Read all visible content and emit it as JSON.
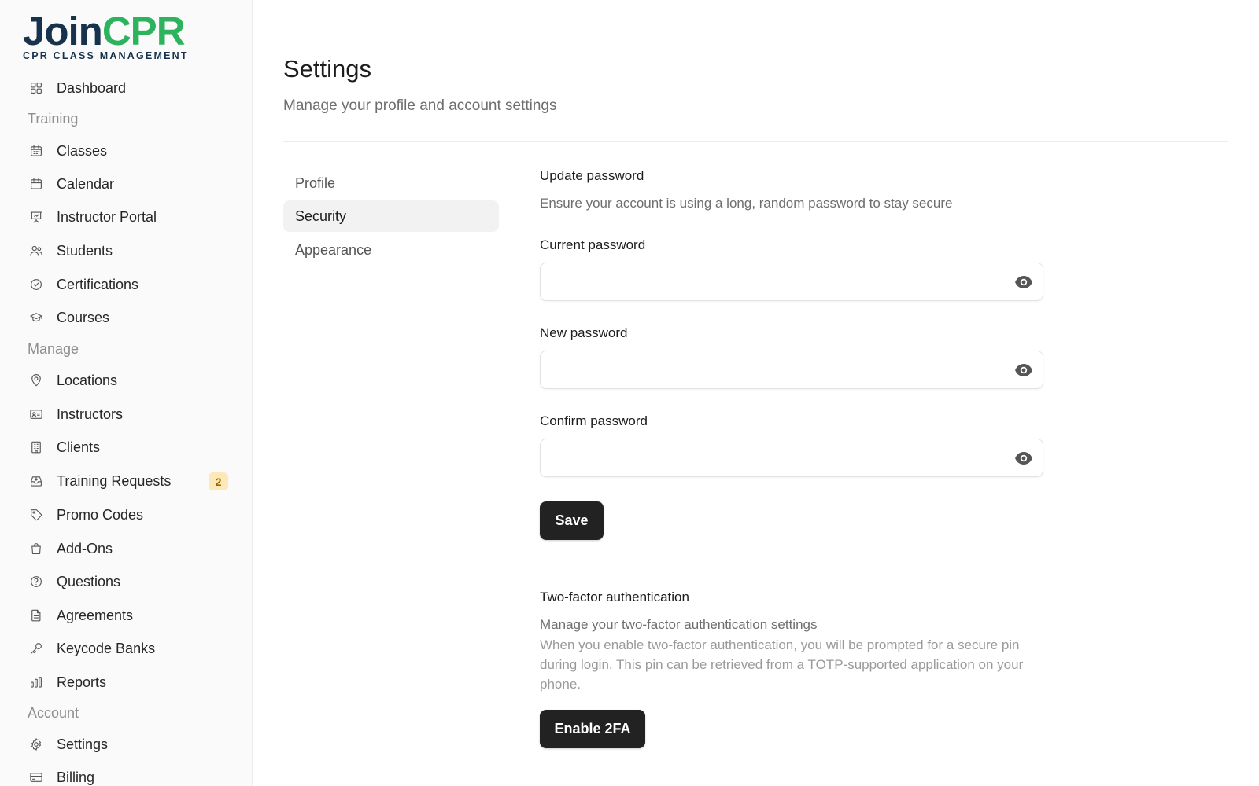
{
  "brand": {
    "word_a": "Join",
    "word_b": "CPR",
    "tagline": "CPR CLASS MANAGEMENT"
  },
  "sidebar": {
    "items": [
      {
        "label": "Dashboard",
        "icon": "grid-icon"
      },
      {
        "group": "Training"
      },
      {
        "label": "Classes",
        "icon": "calendar-grid-icon"
      },
      {
        "label": "Calendar",
        "icon": "calendar-icon"
      },
      {
        "label": "Instructor Portal",
        "icon": "presentation-icon"
      },
      {
        "label": "Students",
        "icon": "users-icon"
      },
      {
        "label": "Certifications",
        "icon": "badge-check-icon"
      },
      {
        "label": "Courses",
        "icon": "graduation-cap-icon"
      },
      {
        "group": "Manage"
      },
      {
        "label": "Locations",
        "icon": "map-pin-icon"
      },
      {
        "label": "Instructors",
        "icon": "id-card-icon"
      },
      {
        "label": "Clients",
        "icon": "building-icon"
      },
      {
        "label": "Training Requests",
        "icon": "inbox-icon",
        "badge": "2"
      },
      {
        "label": "Promo Codes",
        "icon": "tag-icon"
      },
      {
        "label": "Add-Ons",
        "icon": "shopping-bag-icon"
      },
      {
        "label": "Questions",
        "icon": "help-circle-icon"
      },
      {
        "label": "Agreements",
        "icon": "file-text-icon"
      },
      {
        "label": "Keycode Banks",
        "icon": "key-icon"
      },
      {
        "label": "Reports",
        "icon": "bar-chart-icon"
      },
      {
        "group": "Account"
      },
      {
        "label": "Settings",
        "icon": "gear-icon"
      },
      {
        "label": "Billing",
        "icon": "credit-card-icon"
      }
    ]
  },
  "header": {
    "title": "Settings",
    "subtitle": "Manage your profile and account settings"
  },
  "subnav": {
    "items": [
      "Profile",
      "Security",
      "Appearance"
    ],
    "active": "Security"
  },
  "password": {
    "title": "Update password",
    "description": "Ensure your account is using a long, random password to stay secure",
    "current_label": "Current password",
    "current_value": "",
    "new_label": "New password",
    "new_value": "",
    "confirm_label": "Confirm password",
    "confirm_value": "",
    "save_label": "Save"
  },
  "twofa": {
    "title": "Two-factor authentication",
    "description": "Manage your two-factor authentication settings",
    "explanation": "When you enable two-factor authentication, you will be prompted for a secure pin during login. This pin can be retrieved from a TOTP-supported application on your phone.",
    "enable_label": "Enable 2FA"
  },
  "colors": {
    "brand_dark": "#17324d",
    "brand_green": "#2db35d",
    "badge_bg": "#fde9b8",
    "badge_text": "#9a6400",
    "button_bg": "#222222"
  }
}
